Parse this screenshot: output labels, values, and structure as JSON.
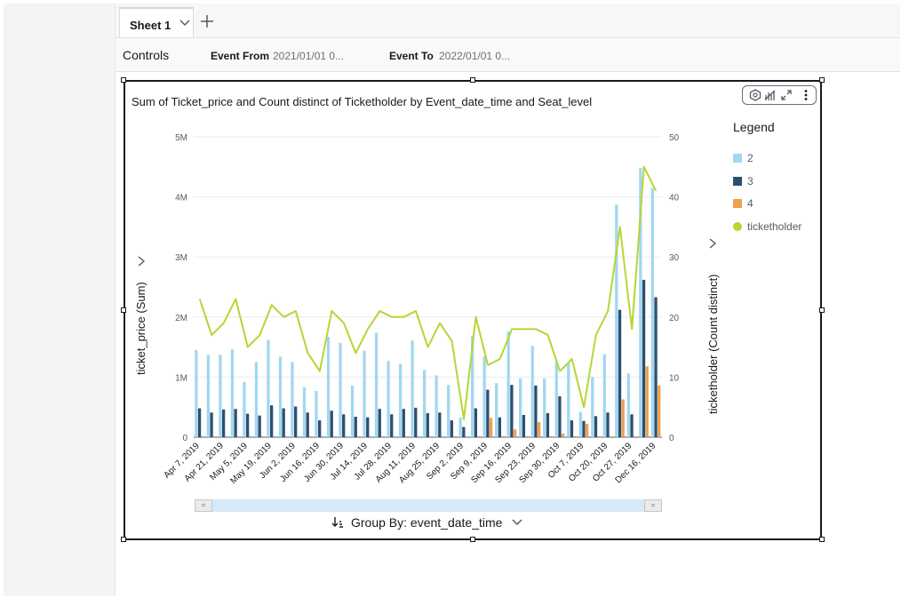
{
  "sheet": {
    "tab_label": "Sheet 1"
  },
  "controls": {
    "label": "Controls",
    "items": [
      {
        "name": "Event From",
        "value": "2021/01/01 0..."
      },
      {
        "name": "Event To",
        "value": "2022/01/01 0..."
      }
    ]
  },
  "visual": {
    "title": "Sum of Ticket_price and Count distinct of Ticketholder by Event_date_time and Seat_level",
    "legend_title": "Legend",
    "group_by_label": "Group By: event_date_time",
    "toolbar_icons": [
      "focus-icon",
      "visual-type-icon",
      "expand-icon",
      "more-menu-icon"
    ]
  },
  "chart_data": {
    "type": "bar",
    "title": "Sum of Ticket_price and Count distinct of Ticketholder by Event_date_time and Seat_level",
    "xlabel": "",
    "ylabel": "ticket_price (Sum)",
    "y2label": "ticketholder (Count distinct)",
    "ylim": [
      0,
      5000000
    ],
    "y2lim": [
      0,
      50
    ],
    "yticks": [
      "0",
      "1M",
      "2M",
      "3M",
      "4M",
      "5M"
    ],
    "y2ticks": [
      "0",
      "10",
      "20",
      "30",
      "40",
      "50"
    ],
    "x_tick_labels": [
      "Apr 7, 2019",
      "Apr 21, 2019",
      "May 5, 2019",
      "May 19, 2019",
      "Jun 2, 2019",
      "Jun 16, 2019",
      "Jun 30, 2019",
      "Jul 14, 2019",
      "Jul 28, 2019",
      "Aug 11, 2019",
      "Aug 25, 2019",
      "Sep 2, 2019",
      "Sep 9, 2019",
      "Sep 16, 2019",
      "Sep 23, 2019",
      "Sep 30, 2019",
      "Oct 7, 2019",
      "Oct 20, 2019",
      "Oct 27, 2019",
      "Dec 16, 2019"
    ],
    "legend_position": "right",
    "grid": true,
    "series": [
      {
        "name": "2",
        "kind": "bar",
        "color": "#a2d7ef",
        "values": [
          1450000,
          1370000,
          1370000,
          1460000,
          920000,
          1250000,
          1620000,
          1340000,
          1250000,
          830000,
          770000,
          1670000,
          1570000,
          860000,
          1440000,
          1740000,
          1270000,
          1220000,
          1610000,
          1120000,
          1030000,
          870000,
          330000,
          1690000,
          1350000,
          900000,
          1760000,
          980000,
          1520000,
          980000,
          1250000,
          1230000,
          420000,
          1000000,
          1380000,
          3870000,
          1060000,
          4480000,
          4150000
        ]
      },
      {
        "name": "3",
        "kind": "bar",
        "color": "#2e4e6f",
        "values": [
          480000,
          410000,
          460000,
          470000,
          390000,
          360000,
          530000,
          480000,
          510000,
          410000,
          280000,
          440000,
          380000,
          340000,
          330000,
          470000,
          380000,
          470000,
          490000,
          400000,
          410000,
          280000,
          170000,
          480000,
          790000,
          330000,
          870000,
          370000,
          860000,
          400000,
          680000,
          280000,
          270000,
          350000,
          410000,
          2120000,
          380000,
          2620000,
          2330000
        ]
      },
      {
        "name": "4",
        "kind": "bar",
        "color": "#f0a04b",
        "values": [
          0,
          0,
          0,
          0,
          0,
          0,
          0,
          0,
          0,
          0,
          0,
          0,
          0,
          0,
          0,
          0,
          0,
          0,
          0,
          0,
          0,
          0,
          0,
          0,
          320000,
          0,
          130000,
          0,
          250000,
          0,
          60000,
          0,
          220000,
          0,
          0,
          630000,
          0,
          1180000,
          860000
        ]
      },
      {
        "name": "ticketholder",
        "kind": "line",
        "axis": "right",
        "color": "#b6d634",
        "values": [
          23,
          17,
          19,
          23,
          15,
          17,
          22,
          20,
          21,
          14,
          11,
          21,
          19,
          14,
          18,
          21,
          20,
          20,
          21,
          15,
          19,
          16,
          3,
          20,
          12,
          13,
          18,
          18,
          18,
          17,
          11,
          13,
          5,
          17,
          21,
          35,
          18,
          45,
          41
        ]
      }
    ]
  }
}
